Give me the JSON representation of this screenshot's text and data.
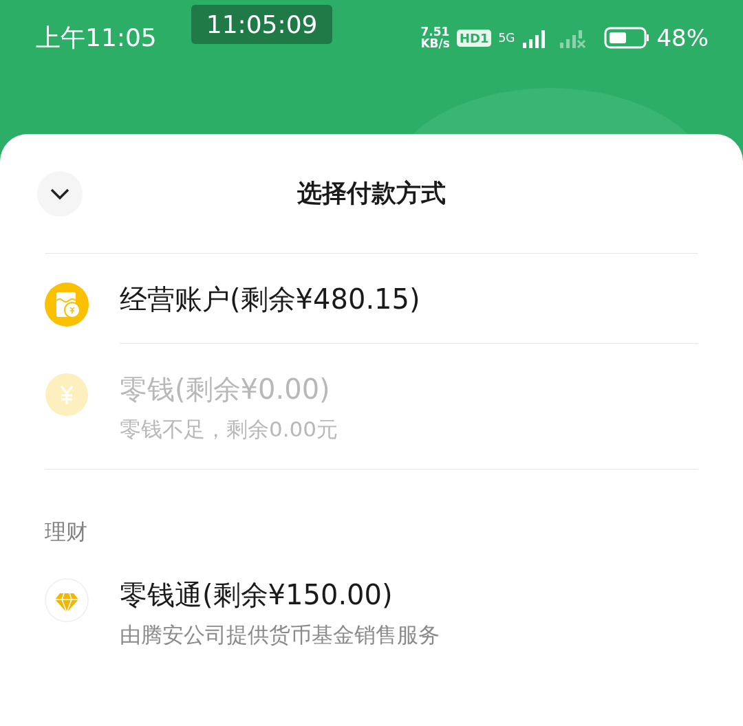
{
  "status_bar": {
    "time": "上午11:05",
    "clock_badge": "11:05:09",
    "net_speed": "7.51",
    "net_unit": "KB/s",
    "hd_badge": "HD1",
    "network_type": "5G",
    "battery": "48%"
  },
  "sheet": {
    "title": "选择付款方式",
    "options": [
      {
        "kind": "store",
        "label": "经营账户(剩余¥480.15)",
        "disabled": false
      },
      {
        "kind": "coin",
        "label": "零钱(剩余¥0.00)",
        "note": "零钱不足，剩余0.00元",
        "disabled": true
      }
    ],
    "sections": [
      {
        "title": "理财",
        "options": [
          {
            "kind": "diamond",
            "label": "零钱通(剩余¥150.00)",
            "note": "由腾安公司提供货币基金销售服务",
            "disabled": false
          }
        ]
      }
    ]
  }
}
